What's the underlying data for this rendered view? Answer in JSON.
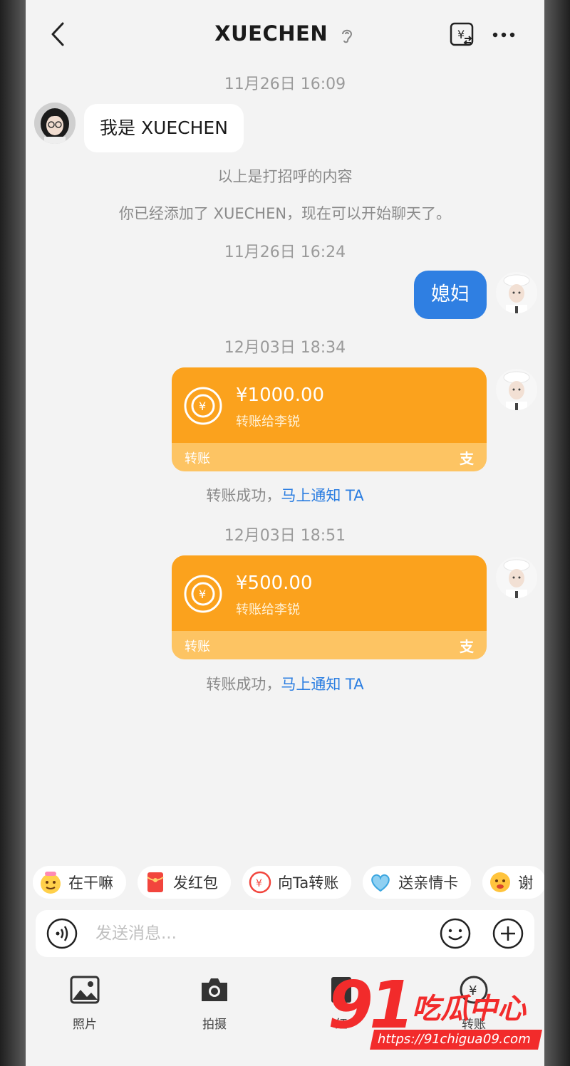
{
  "header": {
    "title": "XUECHEN"
  },
  "messages": {
    "ts1": "11月26日 16:09",
    "greeting": "我是 XUECHEN",
    "sys1": "以上是打招呼的内容",
    "sys2": "你已经添加了 XUECHEN，现在可以开始聊天了。",
    "ts2": "11月26日 16:24",
    "outgoing_text": "媳妇",
    "ts3": "12月03日 18:34",
    "transfer1": {
      "amount": "¥1000.00",
      "to": "转账给李锐",
      "label": "转账",
      "pay_glyph": "支"
    },
    "status1": {
      "text": "转账成功，",
      "link": "马上通知 TA"
    },
    "ts4": "12月03日 18:51",
    "transfer2": {
      "amount": "¥500.00",
      "to": "转账给李锐",
      "label": "转账",
      "pay_glyph": "支"
    },
    "status2": {
      "text": "转账成功，",
      "link": "马上通知 TA"
    }
  },
  "quick_actions": [
    {
      "label": "在干嘛",
      "icon": "emoji-face-icon"
    },
    {
      "label": "发红包",
      "icon": "red-envelope-icon"
    },
    {
      "label": "向Ta转账",
      "icon": "transfer-icon"
    },
    {
      "label": "送亲情卡",
      "icon": "family-card-icon"
    },
    {
      "label": "谢",
      "icon": "emoji-face-icon"
    }
  ],
  "input": {
    "placeholder": "发送消息..."
  },
  "tools": [
    {
      "label": "照片",
      "icon": "photo-icon"
    },
    {
      "label": "拍摄",
      "icon": "camera-icon"
    },
    {
      "label": "红",
      "icon": "red-envelope-icon"
    },
    {
      "label": "转账",
      "icon": "transfer-icon"
    }
  ],
  "watermark": {
    "number": "91",
    "brand": "吃瓜中心",
    "url": "https://91chigua09.com"
  },
  "colors": {
    "accent": "#2f7fe2",
    "transfer": "#fba21d",
    "link": "#2a7de1",
    "watermark": "#f22b2b"
  }
}
